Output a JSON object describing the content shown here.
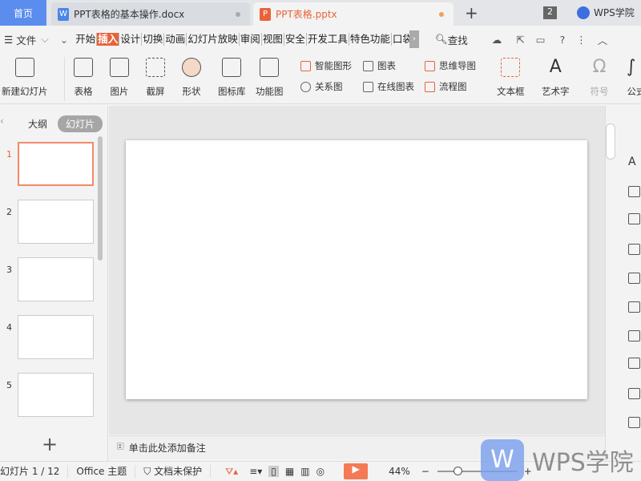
{
  "tabs": {
    "home": "首页",
    "doc": "PPT表格的基本操作.docx",
    "ppt": "PPT表格.pptx",
    "doc_icon": "W",
    "ppt_icon": "P",
    "count": "2",
    "account": "WPS学院"
  },
  "menu": {
    "file": "文件",
    "items": [
      "开始",
      "插入",
      "设计",
      "切换",
      "动画",
      "幻灯片放映",
      "审阅",
      "视图",
      "安全",
      "开发工具",
      "特色功能",
      "口袋"
    ],
    "active": "插入",
    "search": "查找"
  },
  "ribbon": {
    "new_slide": "新建幻灯片",
    "table": "表格",
    "picture": "图片",
    "screenshot": "截屏",
    "shape": "形状",
    "icon_lib": "图标库",
    "func_chart": "功能图",
    "smart_shape": "智能图形",
    "chart": "图表",
    "relation": "关系图",
    "online_chart": "在线图表",
    "mindmap": "思维导图",
    "flowchart": "流程图",
    "textbox": "文本框",
    "wordart": "艺术字",
    "symbol": "符号",
    "formula": "公式"
  },
  "panel": {
    "outline": "大纲",
    "slides": "幻灯片",
    "slide_numbers": [
      "1",
      "2",
      "3",
      "4",
      "5"
    ]
  },
  "notes": {
    "placeholder": "单击此处添加备注"
  },
  "status": {
    "slide": "幻灯片 1 / 12",
    "theme": "Office 主题",
    "protect": "文档未保护",
    "zoom": "44%"
  },
  "watermark": "WPS学院",
  "colors": {
    "accent": "#e8633a",
    "home_tab": "#5b8def"
  }
}
